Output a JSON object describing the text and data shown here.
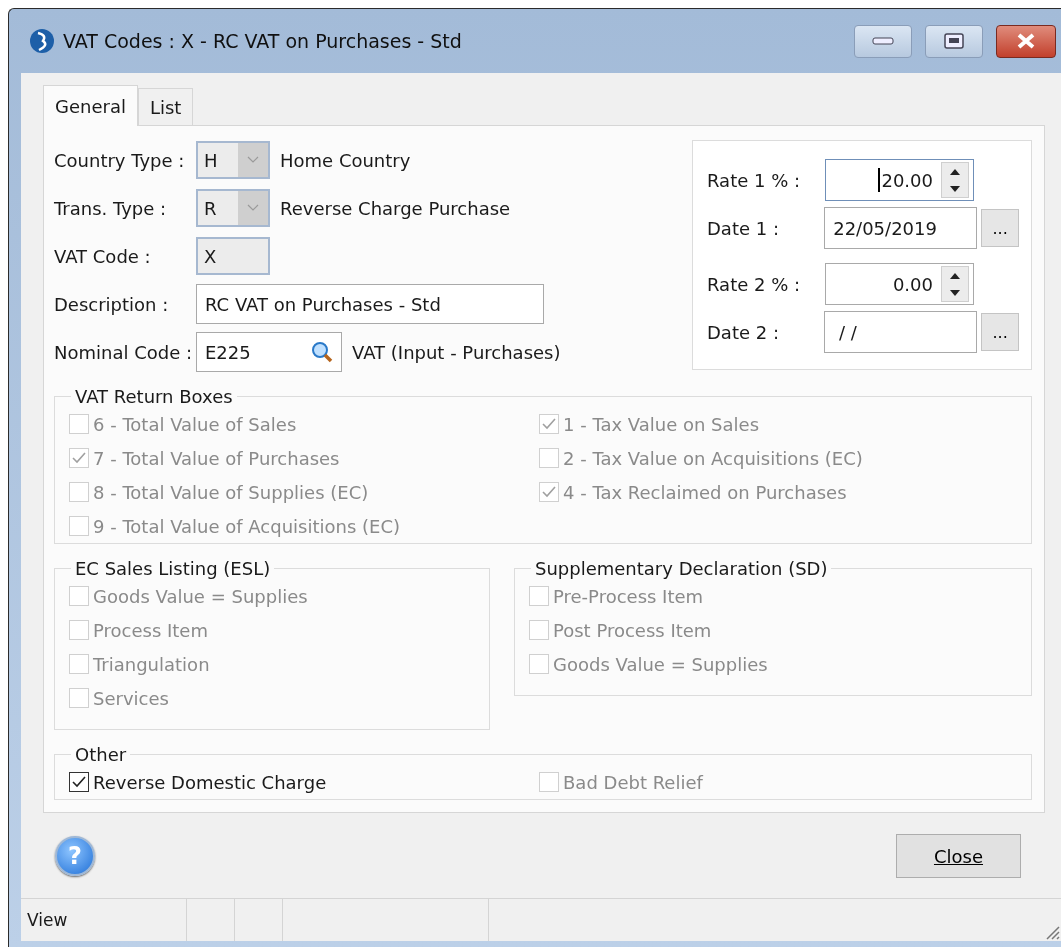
{
  "window": {
    "title": "VAT Codes : X - RC VAT on Purchases - Std"
  },
  "tabs": [
    {
      "label": "General",
      "selected": true
    },
    {
      "label": "List",
      "selected": false
    }
  ],
  "fields": [
    {
      "kind": "dropdown",
      "label": "Country Type :",
      "value": "H",
      "note": "Home Country"
    },
    {
      "kind": "dropdown",
      "label": "Trans. Type :",
      "value": "R",
      "note": "Reverse Charge Purchase"
    },
    {
      "kind": "readonly",
      "label": "VAT Code :",
      "value": "X"
    },
    {
      "kind": "text",
      "label": "Description :",
      "value": "RC VAT on Purchases - Std"
    },
    {
      "kind": "lookup",
      "label": "Nominal Code :",
      "value": "E225",
      "note": "VAT (Input - Purchases)"
    }
  ],
  "rates": [
    {
      "kind": "spin",
      "label": "Rate 1 % :",
      "value": "20.00",
      "focused": true
    },
    {
      "kind": "date",
      "label": "Date 1 :",
      "value": "22/05/2019",
      "button": "..."
    },
    {
      "kind": "spin",
      "label": "Rate 2 % :",
      "value": "0.00",
      "focused": false
    },
    {
      "kind": "date",
      "label": "Date 2 :",
      "value": " / /",
      "button": "..."
    }
  ],
  "vat_return_boxes": {
    "title": "VAT Return Boxes",
    "columns": [
      [
        {
          "label": "6 - Total Value of Sales",
          "checked": false,
          "disabled": true
        },
        {
          "label": "7 - Total Value of Purchases",
          "checked": true,
          "disabled": true
        },
        {
          "label": "8 - Total Value of Supplies (EC)",
          "checked": false,
          "disabled": true
        },
        {
          "label": "9 - Total Value of Acquisitions (EC)",
          "checked": false,
          "disabled": true
        }
      ],
      [
        {
          "label": "1 - Tax Value on Sales",
          "checked": true,
          "disabled": true
        },
        {
          "label": "2 - Tax Value on Acquisitions (EC)",
          "checked": false,
          "disabled": true
        },
        {
          "label": "4 - Tax Reclaimed on Purchases",
          "checked": true,
          "disabled": true
        }
      ]
    ]
  },
  "ec_sales_listing": {
    "title": "EC Sales Listing (ESL)",
    "items": [
      {
        "label": "Goods Value = Supplies",
        "checked": false,
        "disabled": true
      },
      {
        "label": "Process Item",
        "checked": false,
        "disabled": true
      },
      {
        "label": "Triangulation",
        "checked": false,
        "disabled": true
      },
      {
        "label": "Services",
        "checked": false,
        "disabled": true
      }
    ]
  },
  "supplementary_declaration": {
    "title": "Supplementary Declaration (SD)",
    "items": [
      {
        "label": "Pre-Process Item",
        "checked": false,
        "disabled": true
      },
      {
        "label": "Post Process Item",
        "checked": false,
        "disabled": true
      },
      {
        "label": "Goods Value = Supplies",
        "checked": false,
        "disabled": true
      }
    ]
  },
  "other": {
    "title": "Other",
    "items": [
      {
        "label": "Reverse Domestic Charge",
        "checked": true,
        "disabled": false
      },
      {
        "label": "Bad Debt Relief",
        "checked": false,
        "disabled": true
      }
    ]
  },
  "footer": {
    "help": "?",
    "close_button": "Close"
  },
  "status_bar": {
    "text": "View"
  }
}
